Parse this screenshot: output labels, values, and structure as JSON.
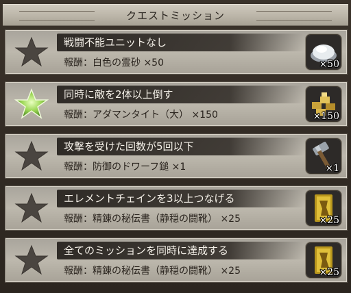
{
  "header": {
    "title": "クエストミッション"
  },
  "missions": [
    {
      "name": "戦闘不能ユニットなし",
      "reward": "報酬：白色の霊砂 ×50",
      "completed": false,
      "icon": "white-sand-icon",
      "qty": "×50"
    },
    {
      "name": "同時に敵を2体以上倒す",
      "reward": "報酬：アダマンタイト（大） ×150",
      "completed": true,
      "icon": "adamantite-icon",
      "qty": "×150"
    },
    {
      "name": "攻撃を受けた回数が5回以下",
      "reward": "報酬：防御のドワーフ鎚 ×1",
      "completed": false,
      "icon": "dwarf-hammer-icon",
      "qty": "×1"
    },
    {
      "name": "エレメントチェインを3以上つなげる",
      "reward": "報酬：精錬の秘伝書（静穏の闘靴） ×25",
      "completed": false,
      "icon": "tome-icon",
      "qty": "×25"
    },
    {
      "name": "全てのミッションを同時に達成する",
      "reward": "報酬：精錬の秘伝書（静穏の闘靴） ×25",
      "completed": false,
      "icon": "tome-icon",
      "qty": "×25"
    }
  ],
  "colors": {
    "star_done": "#8fd14a",
    "star_pending": "#4a4540"
  }
}
